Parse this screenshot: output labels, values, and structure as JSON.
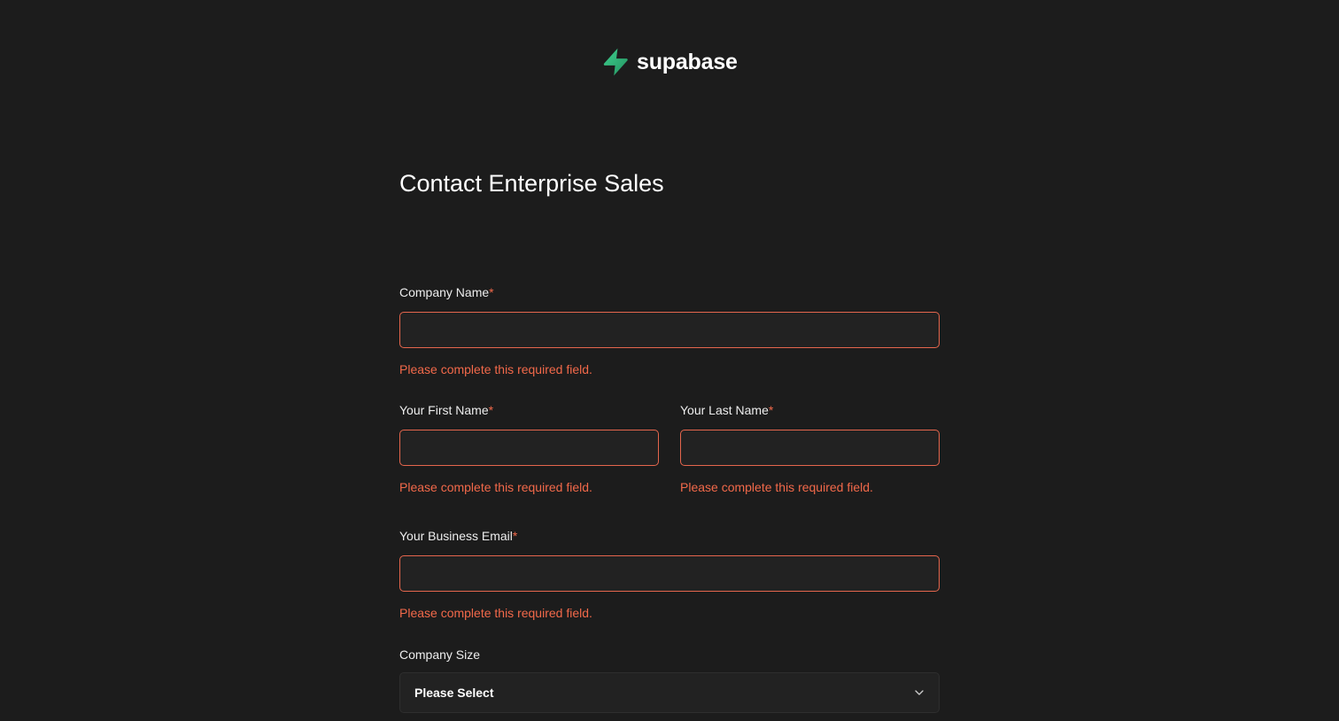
{
  "brand": {
    "name": "supabase",
    "accent_color": "#3ecf8e"
  },
  "page": {
    "title": "Contact Enterprise Sales"
  },
  "form": {
    "required_marker": "*",
    "error_color": "#f2694a",
    "company_name": {
      "label": "Company Name",
      "value": "",
      "error": "Please complete this required field."
    },
    "first_name": {
      "label": "Your First Name",
      "value": "",
      "error": "Please complete this required field."
    },
    "last_name": {
      "label": "Your Last Name",
      "value": "",
      "error": "Please complete this required field."
    },
    "business_email": {
      "label": "Your Business Email",
      "value": "",
      "error": "Please complete this required field."
    },
    "company_size": {
      "label": "Company Size",
      "selected": "Please Select",
      "icon": "chevron-down-icon"
    }
  }
}
